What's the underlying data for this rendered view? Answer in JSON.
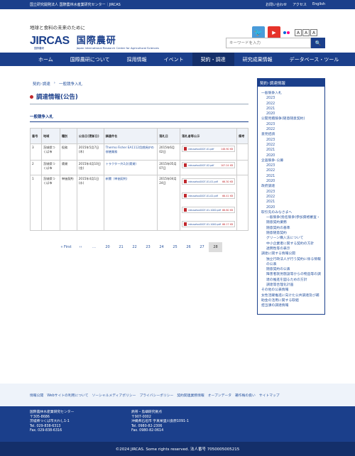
{
  "topbar": {
    "org": "国立研究開発法人 国際農林水産業研究センター｜JIRCAS",
    "links": [
      "お問い合わせ",
      "アクセス",
      "English"
    ]
  },
  "header": {
    "tagline": "地球と食料の未来のために",
    "logo_text": "JIRCAS",
    "logo_sub": "国際農研",
    "org_jp": "国際農研",
    "org_en": "Japan International Research Center for Agricultural Sciences",
    "font_sizes": [
      "A",
      "A",
      "A"
    ],
    "search_placeholder": "キーワードを入力"
  },
  "nav": [
    "ホーム",
    "国際農研について",
    "採用情報",
    "イベント",
    "契約・調達",
    "研究成果情報",
    "データベース・ツール"
  ],
  "breadcrumb": [
    "契約･調達",
    "一般競争入札"
  ],
  "page_title": "調達情報(公告)",
  "section_title": "一般競争入札",
  "table": {
    "headers": [
      "番号",
      "地域",
      "種別",
      "公告日(更新日)",
      "調達件名",
      "落札日",
      "落札者等公示",
      "備考"
    ],
    "rows": [
      {
        "no": "3",
        "region": "茨城県つくば市",
        "type": "役務",
        "date": "2015年5月7日(木)",
        "title": "Thermo Fisher EA1112用燃焼炉の修繕業務",
        "award": "2015年6月02日",
        "files": [
          {
            "name": "rakusatsu0007-01.pdf",
            "size": "148.90 KB"
          }
        ]
      },
      {
        "no": "2",
        "region": "茨城県つくば市",
        "type": "賃貸",
        "date": "2015年4月10日(金)",
        "title": "トラクター外2点(賃貸)",
        "award": "2015年05月07日",
        "files": [
          {
            "name": "rakusatsu0007-02.pdf",
            "size": "107.24 KB"
          }
        ]
      },
      {
        "no": "1",
        "region": "茨城県つくば市",
        "type": "単価契約",
        "date": "2015年4月1日(水)",
        "title": "新聞（単価契約）",
        "award": "2015年04月24日",
        "files": [
          {
            "name": "rakusatsu0007-01-01.pdf",
            "size": "66.30 KB"
          },
          {
            "name": "rakusatsu0007-01-02.pdf",
            "size": "66.41 KB"
          },
          {
            "name": "rakusatsu0007-01-1000.pdf",
            "size": "66.80 KB"
          },
          {
            "name": "rakusatsu0007-01-1000.pdf",
            "size": "66.17 KB"
          }
        ]
      }
    ]
  },
  "pager": [
    "« First",
    "‹‹",
    "…",
    "20",
    "21",
    "22",
    "23",
    "24",
    "25",
    "26",
    "27",
    "28"
  ],
  "pager_current": "28",
  "sidebar": {
    "title": "契約･調達情報",
    "items": [
      {
        "level": 1,
        "label": "一般競争入札"
      },
      {
        "level": 2,
        "label": "2023"
      },
      {
        "level": 2,
        "label": "2022"
      },
      {
        "level": 2,
        "label": "2021"
      },
      {
        "level": 2,
        "label": "2020"
      },
      {
        "level": 1,
        "label": "公開見積競争(随意随意契約)"
      },
      {
        "level": 2,
        "label": "2023"
      },
      {
        "level": 2,
        "label": "2022"
      },
      {
        "level": 1,
        "label": "意見招請"
      },
      {
        "level": 2,
        "label": "2023"
      },
      {
        "level": 2,
        "label": "2022"
      },
      {
        "level": 2,
        "label": "2021"
      },
      {
        "level": 2,
        "label": "2020"
      },
      {
        "level": 1,
        "label": "企画競争･公募"
      },
      {
        "level": 2,
        "label": "2023"
      },
      {
        "level": 2,
        "label": "2022"
      },
      {
        "level": 2,
        "label": "2021"
      },
      {
        "level": 2,
        "label": "2020"
      },
      {
        "level": 1,
        "label": "政府調達"
      },
      {
        "level": 2,
        "label": "2023"
      },
      {
        "level": 2,
        "label": "2022"
      },
      {
        "level": 2,
        "label": "2021"
      },
      {
        "level": 2,
        "label": "2020"
      },
      {
        "level": 1,
        "label": "取引先のみなさまへ"
      },
      {
        "level": 2,
        "label": "一般競争(指名競争)参加資格審査・随意契約業務"
      },
      {
        "level": 2,
        "label": "随意契約の基準"
      },
      {
        "level": 2,
        "label": "随意随意契約"
      },
      {
        "level": 2,
        "label": "グリーン購入法について"
      },
      {
        "level": 2,
        "label": "中小企業者に関する契約の方針"
      },
      {
        "level": 2,
        "label": "透明性等の表示"
      },
      {
        "level": 1,
        "label": "調達に関する情報公開"
      },
      {
        "level": 2,
        "label": "独立行政法人が行う契約に係る情報の公表"
      },
      {
        "level": 2,
        "label": "随意契約の公表"
      },
      {
        "level": 2,
        "label": "障害者就労施設等からの物品等の調達の推進を図るための方針"
      },
      {
        "level": 2,
        "label": "調達等合理化計画"
      },
      {
        "level": 1,
        "label": "その他の公表情報"
      },
      {
        "level": 1,
        "label": "女性活躍推進に向けた公共調達及び補助金の活用に関する取組"
      },
      {
        "level": 1,
        "label": "担当課の調達情報"
      }
    ]
  },
  "footer_links": [
    "情報公開",
    "Webサイトの利用について",
    "ソーシャルメディアポリシー",
    "プライバシーポリシー",
    "契約関連業務情報",
    "オープンデータ",
    "著作権の扱い",
    "サイトマップ"
  ],
  "footer": {
    "left": [
      "国際農林水産業研究センター",
      "〒305-8686",
      "茨城県つくば市大わし1-1",
      "Tel. 029-838-6313",
      "Fax. 029-838-6316"
    ],
    "right": [
      "熱帯・島嶼研究拠点",
      "〒907-0002",
      "沖縄県石垣市 字真栄里川良原1091-1",
      "Tel. 0980-82-2306",
      "Fax. 0980-82-0614"
    ]
  },
  "copyright": "©2024 JIRCAS. Some rights reserved. 法人番号 7050005005215"
}
